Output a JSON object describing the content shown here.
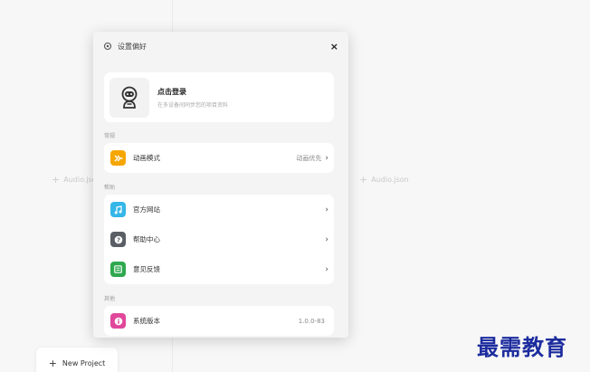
{
  "background": {
    "track_left_label": "Audio.json",
    "track_right_label": "Audio.json",
    "new_project_label": "New Project"
  },
  "modal": {
    "title": "设置偏好",
    "close_label": "×",
    "profile": {
      "title": "点击登录",
      "subtitle": "在多设备间同步您的项目资料"
    },
    "sections": {
      "general": {
        "label": "常规",
        "items": [
          {
            "label": "动画模式",
            "value": "动画优先",
            "icon": "animation-icon",
            "color": "#f5a600"
          }
        ]
      },
      "help": {
        "label": "帮助",
        "items": [
          {
            "label": "官方网站",
            "icon": "music-note-icon",
            "color": "#35b6e8"
          },
          {
            "label": "帮助中心",
            "icon": "question-icon",
            "color": "#5a5f66"
          },
          {
            "label": "意见反馈",
            "icon": "feedback-icon",
            "color": "#2fa84f"
          }
        ]
      },
      "other": {
        "label": "其他",
        "items": [
          {
            "label": "系统版本",
            "value": "1.0.0-83",
            "icon": "info-icon",
            "color": "#e0479a"
          }
        ]
      }
    }
  },
  "watermark": "最需教育"
}
